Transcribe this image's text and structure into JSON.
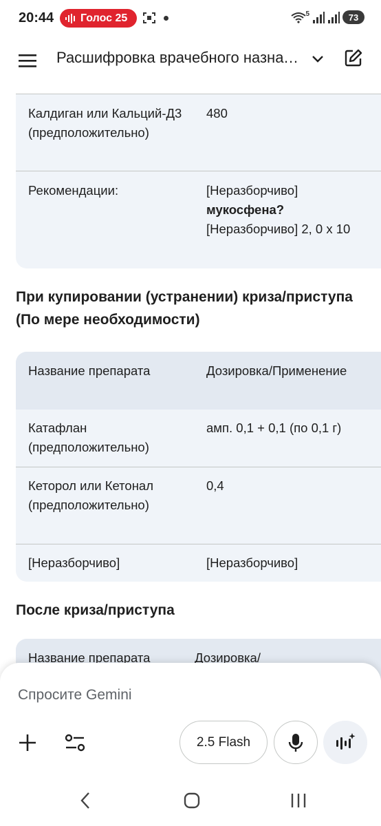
{
  "status_bar": {
    "time": "20:44",
    "recording_label": "Голос 25",
    "signal_label": "5",
    "battery": "73",
    "accent_color": "#e0242e"
  },
  "app_bar": {
    "title": "Расшифровка врачебного назначения",
    "icons": [
      "menu-icon",
      "chevron-down-icon",
      "edit-icon"
    ]
  },
  "table1": {
    "rows": [
      {
        "name": "Калдиган или Кальций-Д3 (предположительно)",
        "dose_plain": "480",
        "dose_bold": ""
      },
      {
        "name": "Рекомендации:",
        "dose_pre": "[Неразборчиво]",
        "dose_bold": "мукосфена?",
        "dose_post": "[Неразборчиво] 2, 0 x 10"
      }
    ]
  },
  "section2": {
    "heading": "При купировании (устранении) криза/приступа (По мере необходимости)",
    "header": {
      "col1": "Название препарата",
      "col2": "Дозировка/Применение"
    },
    "rows": [
      {
        "name": "Катафлан (предположительно)",
        "dose": "амп. 0,1 + 0,1 (по 0,1 г)"
      },
      {
        "name": "Кеторол или Кетонал (предположительно)",
        "dose": "0,4"
      },
      {
        "name": "[Неразборчиво]",
        "dose": "[Неразборчиво]"
      }
    ]
  },
  "section3": {
    "heading": "После криза/приступа",
    "header": {
      "col1": "Название препарата",
      "col2": "Дозировка/"
    }
  },
  "input_panel": {
    "placeholder": "Спросите Gemini",
    "model_label": "2.5 Flash",
    "icons": [
      "plus-icon",
      "tools-icon",
      "mic-icon",
      "live-icon"
    ]
  },
  "nav_bar": {
    "icons": [
      "back-icon",
      "home-icon",
      "recents-icon"
    ]
  }
}
